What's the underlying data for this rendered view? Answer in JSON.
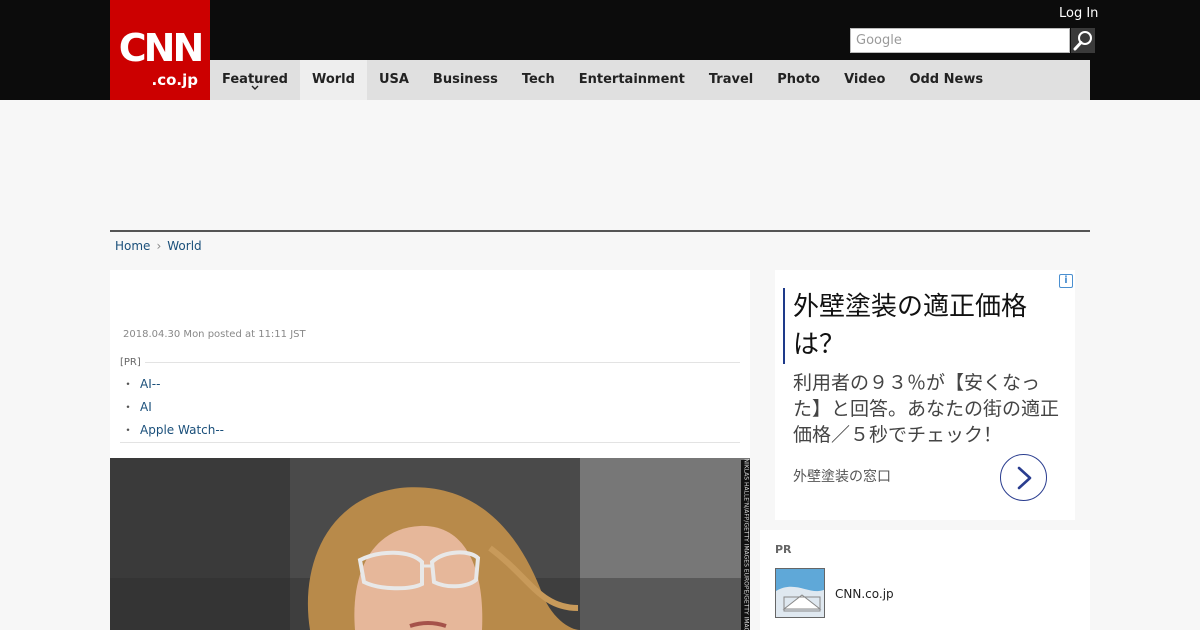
{
  "header": {
    "logo_main": "CNN",
    "logo_sub": ".co.jp",
    "login": "Log In",
    "search_placeholder": "Google"
  },
  "nav": [
    {
      "label": "Featured",
      "has_caret": true
    },
    {
      "label": "World",
      "active": true
    },
    {
      "label": "USA"
    },
    {
      "label": "Business"
    },
    {
      "label": "Tech"
    },
    {
      "label": "Entertainment"
    },
    {
      "label": "Travel"
    },
    {
      "label": "Photo"
    },
    {
      "label": "Video"
    },
    {
      "label": "Odd News"
    }
  ],
  "breadcrumb": [
    "Home",
    "World"
  ],
  "article": {
    "posted": "2018.04.30 Mon posted at 11:11 JST",
    "pr_label": "[PR]",
    "pr_links": [
      "AI--",
      "AI",
      "Apple Watch--"
    ],
    "photo_credit": "NIKLAS HALLE'N/AFP/GETTY IMAGES EUROPE/GETTY IMAGES"
  },
  "ad": {
    "headline": "外壁塗装の適正価格は？",
    "body": "利用者の９３％が【安くなった】と回答。あなたの街の適正価格／５秒でチェック！",
    "source": "外壁塗装の窓口",
    "info_glyph": "i"
  },
  "pr_widget": {
    "label": "PR",
    "item_title": "CNN.co.jp"
  },
  "colors": {
    "brand_red": "#cc0000",
    "header_bg": "#0c0c0c",
    "nav_bg": "#e0e0e0",
    "link": "#1a4f7a",
    "ad_accent": "#2a3d8f"
  }
}
